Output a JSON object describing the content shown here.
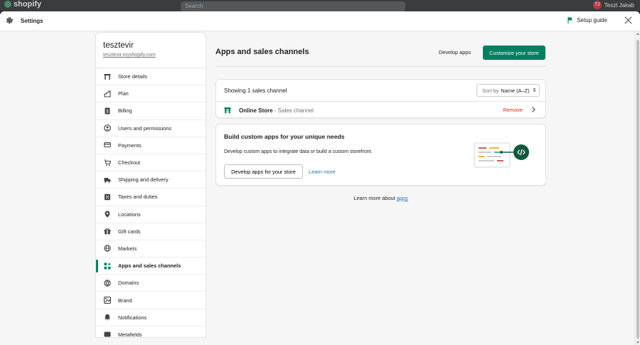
{
  "appbar": {
    "logo": "shopify",
    "search_placeholder": "Search",
    "user_initials": "TJ",
    "user_name": "Teszt Jakab"
  },
  "header": {
    "icon": "gear-icon",
    "title": "Settings",
    "setup_guide": "Setup guide",
    "close_icon": "close-icon"
  },
  "sidebar": {
    "store_name": "tesztevir",
    "store_url": "tesztevir.myshopify.com",
    "items": [
      {
        "label": "Store details",
        "icon": "store-icon"
      },
      {
        "label": "Plan",
        "icon": "plan-icon"
      },
      {
        "label": "Billing",
        "icon": "billing-icon"
      },
      {
        "label": "Users and permissions",
        "icon": "user-icon"
      },
      {
        "label": "Payments",
        "icon": "payments-icon"
      },
      {
        "label": "Checkout",
        "icon": "cart-icon"
      },
      {
        "label": "Shipping and delivery",
        "icon": "truck-icon"
      },
      {
        "label": "Taxes and duties",
        "icon": "taxes-icon"
      },
      {
        "label": "Locations",
        "icon": "location-icon"
      },
      {
        "label": "Gift cards",
        "icon": "gift-icon"
      },
      {
        "label": "Markets",
        "icon": "globe-icon"
      },
      {
        "label": "Apps and sales channels",
        "icon": "apps-icon",
        "active": true
      },
      {
        "label": "Domains",
        "icon": "domains-icon"
      },
      {
        "label": "Brand",
        "icon": "brand-icon"
      },
      {
        "label": "Notifications",
        "icon": "bell-icon"
      },
      {
        "label": "Metafields",
        "icon": "metafields-icon"
      }
    ]
  },
  "main": {
    "title": "Apps and sales channels",
    "develop_apps": "Develop apps",
    "customize_store": "Customize your store",
    "channels": {
      "showing_text": "Showing 1 sales channel",
      "sort_prefix": "Sort by",
      "sort_value": "Name (A–Z)",
      "rows": [
        {
          "name": "Online Store",
          "type": "Sales channel",
          "action": "Remove"
        }
      ]
    },
    "build": {
      "title": "Build custom apps for your unique needs",
      "description": "Develop custom apps to integrate data or build a custom storefront.",
      "primary": "Develop apps for your store",
      "secondary": "Learn more"
    },
    "learn_more_prefix": "Learn more about",
    "learn_more_link": "apps"
  },
  "colors": {
    "primary": "#008060",
    "link": "#2c6ecb",
    "critical": "#d72c0d"
  }
}
